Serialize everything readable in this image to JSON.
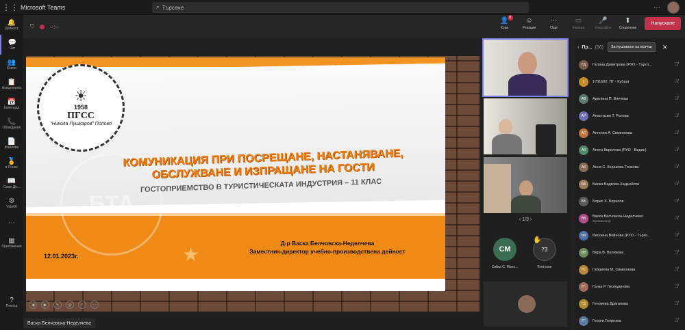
{
  "app": {
    "title": "Microsoft Teams",
    "search_placeholder": "Търсене"
  },
  "rail": [
    {
      "icon": "bell-icon",
      "glyph": "🔔",
      "label": "Дейност"
    },
    {
      "icon": "chat-icon",
      "glyph": "💬",
      "label": "Чат",
      "active": true
    },
    {
      "icon": "teams-icon",
      "glyph": "👥",
      "label": "Екипи"
    },
    {
      "icon": "assignments-icon",
      "glyph": "📋",
      "label": "Assignments"
    },
    {
      "icon": "calendar-icon",
      "glyph": "📅",
      "label": "Календар"
    },
    {
      "icon": "calls-icon",
      "glyph": "📞",
      "label": "Обаждания"
    },
    {
      "icon": "files-icon",
      "glyph": "📄",
      "label": "Файлове"
    },
    {
      "icon": "praise-icon",
      "glyph": "🏅",
      "label": "в Praise"
    },
    {
      "icon": "book-icon",
      "glyph": "📖",
      "label": "Семе.Дн..."
    },
    {
      "icon": "apps-icon",
      "glyph": "⚙",
      "label": "Vido00"
    },
    {
      "icon": "more-icon",
      "glyph": "⋯",
      "label": ""
    },
    {
      "icon": "store-icon",
      "glyph": "▦",
      "label": "Приложения"
    }
  ],
  "rail_help": {
    "icon": "help-icon",
    "glyph": "?",
    "label": "Помощ"
  },
  "meeting_toolbar": {
    "timer": "--:--",
    "buttons": [
      {
        "name": "people-button",
        "icon": "people-icon",
        "glyph": "👤",
        "label": "Хора",
        "badge": "8",
        "dim": false
      },
      {
        "name": "reactions-button",
        "icon": "reactions-icon",
        "glyph": "☺",
        "label": "Реакции",
        "dim": false
      },
      {
        "name": "more-button",
        "icon": "more-icon",
        "glyph": "⋯",
        "label": "Още",
        "dim": false
      },
      {
        "name": "camera-button",
        "icon": "camera-icon",
        "glyph": "▭",
        "label": "Камера",
        "dim": true
      },
      {
        "name": "mic-button",
        "icon": "mic-icon",
        "glyph": "🎤",
        "label": "Микрофон",
        "dim": true
      },
      {
        "name": "share-button",
        "icon": "share-icon",
        "glyph": "⬆",
        "label": "Споделяне",
        "dim": false
      }
    ],
    "leave_label": "Напускане"
  },
  "slide": {
    "logo_year": "1958",
    "logo_name": "ПГСС",
    "logo_sub": "\"Никола Пушкаров\" Попово",
    "title": "КОМУНИКАЦИЯ ПРИ ПОСРЕЩАНЕ, НАСТАНЯВАНЕ, ОБСЛУЖВАНЕ И ИЗПРАЩАНЕ НА ГОСТИ",
    "subtitle": "ГОСТОПРИЕМСТВО  В ТУРИСТИЧЕСКАТА ИНДУСТРИЯ – 11 КЛАС",
    "author": "Д-р Васка Белчовска-Неделчева",
    "author_role": "Заместник-директор учебно-производствена дейност",
    "date": "12.01.2023г.",
    "watermark": "БТА"
  },
  "share_label": "Васка Белчовска-Неделчева",
  "videos": {
    "pager": "1/3",
    "avatar1": {
      "initials": "СМ",
      "caption": "Сийка С. Мано...",
      "color": "#3b6e50"
    },
    "avatar2": {
      "count": "73",
      "caption": "Everyone",
      "hand": "✋"
    }
  },
  "panel": {
    "title": "Пр...",
    "count": "(56)",
    "mute_all": "Заглушаване на всички",
    "participants": [
      {
        "name": "Галина Димитрова (РУО - Търгo...",
        "initials": "ГД",
        "color": "#7a5c4e",
        "role": ""
      },
      {
        "name": "1701602: ПГ - Кубрат",
        "initials": "1",
        "color": "#c88b2a",
        "role": ""
      },
      {
        "name": "Аделина П. Внечева",
        "initials": "АВ",
        "color": "#5e7a6b",
        "role": ""
      },
      {
        "name": "Анастасия Т. Ролева",
        "initials": "АР",
        "color": "#6b6fb5",
        "role": ""
      },
      {
        "name": "Ангелия А. Симеонова",
        "initials": "АС",
        "color": "#c0733b",
        "role": ""
      },
      {
        "name": "Анета Кирилова (РУО - Видин)",
        "initials": "АК",
        "color": "#4f8a6a",
        "role": ""
      },
      {
        "name": "Анна С. Коракова-Тонкова",
        "initials": "АК",
        "color": "#8c6b55",
        "role": ""
      },
      {
        "name": "Бинка Бадкова-Хаджийска",
        "initials": "ББ",
        "color": "#9a7c5a",
        "role": ""
      },
      {
        "name": "Борис Х. Борисов",
        "initials": "ББ",
        "color": "#5a5a5a",
        "role": ""
      },
      {
        "name": "Васка Белчовска-Неделчева",
        "initials": "ВБ",
        "color": "#b0508a",
        "role": "Организатор"
      },
      {
        "name": "Виолина Войнова (РУО - Търго...",
        "initials": "ВВ",
        "color": "#4d6fa8",
        "role": ""
      },
      {
        "name": "Вяра В. Великова",
        "initials": "ВВ",
        "color": "#6a8a5a",
        "role": ""
      },
      {
        "name": "Габриела М. Симеонова",
        "initials": "ГС",
        "color": "#b8863a",
        "role": ""
      },
      {
        "name": "Ганка Р. Господинова",
        "initials": "ГГ",
        "color": "#a0695a",
        "role": ""
      },
      {
        "name": "Генoвева Драганова",
        "initials": "ГД",
        "color": "#b08a2a",
        "role": ""
      },
      {
        "name": "Георги Георгиев",
        "initials": "ГГ",
        "color": "#5a7aa0",
        "role": ""
      }
    ]
  }
}
